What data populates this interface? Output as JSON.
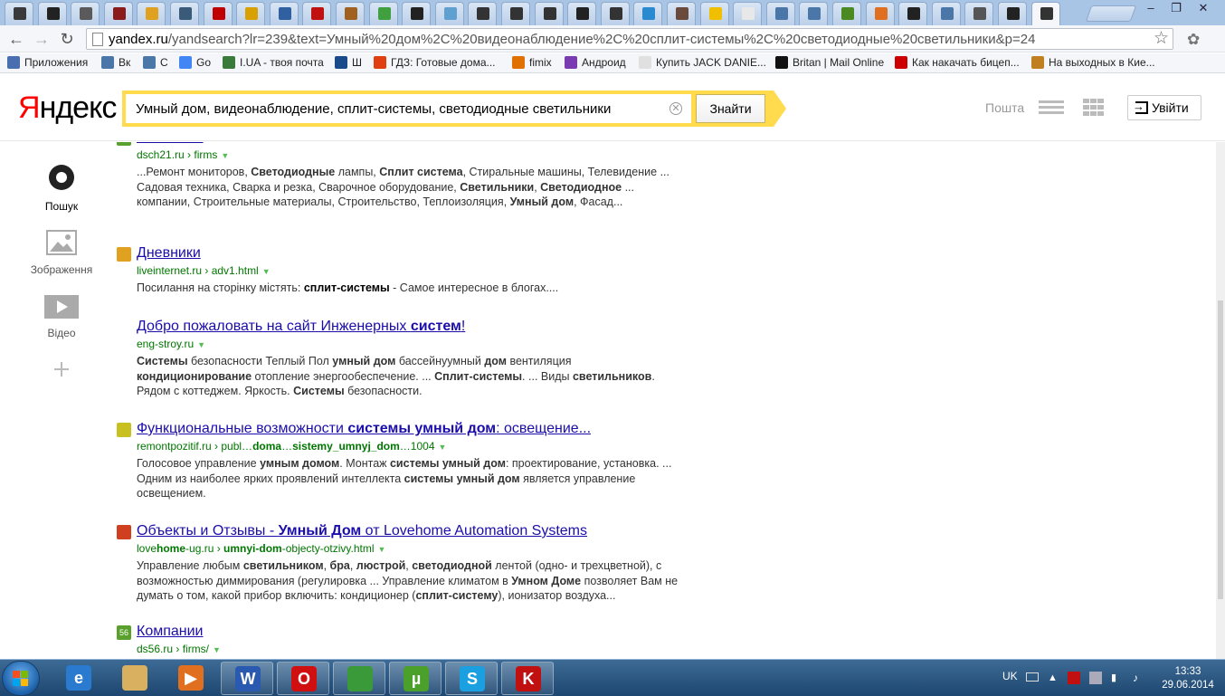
{
  "browser": {
    "tabs": [
      {
        "color": "#3a3a3a"
      },
      {
        "color": "#222222"
      },
      {
        "color": "#5a5a5a"
      },
      {
        "color": "#8b1a1a"
      },
      {
        "color": "#e0a020"
      },
      {
        "color": "#3a5a7a"
      },
      {
        "color": "#c00000"
      },
      {
        "color": "#d8a000"
      },
      {
        "color": "#3060a0"
      },
      {
        "color": "#c01010"
      },
      {
        "color": "#a06020"
      },
      {
        "color": "#40a040"
      },
      {
        "color": "#222222"
      },
      {
        "color": "#60a0d0"
      },
      {
        "color": "#333333"
      },
      {
        "color": "#333333"
      },
      {
        "color": "#333333"
      },
      {
        "color": "#222222"
      },
      {
        "color": "#333333"
      },
      {
        "color": "#2a8ad0"
      },
      {
        "color": "#6a4a3a"
      },
      {
        "color": "#f0c000"
      },
      {
        "color": "#e8e8e8"
      },
      {
        "color": "#4a76a8"
      },
      {
        "color": "#4a76a8"
      },
      {
        "color": "#4a8a20"
      },
      {
        "color": "#e07020"
      },
      {
        "color": "#222222"
      },
      {
        "color": "#4a76a8"
      },
      {
        "color": "#555555"
      },
      {
        "color": "#222222"
      },
      {
        "color": "#333333"
      }
    ],
    "address": {
      "domain": "yandex.ru",
      "path": "/yandsearch?lr=239&text=Умный%20дом%2C%20видеонаблюдение%2C%20сплит-системы%2C%20светодиодные%20светильники&p=24"
    },
    "bookmarks": [
      {
        "label": "Приложения",
        "color": "#4a6fb0"
      },
      {
        "label": "Вк",
        "color": "#4a76a8"
      },
      {
        "label": "С",
        "color": "#4a76a8"
      },
      {
        "label": "Go",
        "color": "#4285f4"
      },
      {
        "label": "I.UA - твоя почта",
        "color": "#3a7a3a"
      },
      {
        "label": "Ш",
        "color": "#1a4a8a"
      },
      {
        "label": "ГДЗ: Готовые дома...",
        "color": "#e04010"
      },
      {
        "label": "fimix",
        "color": "#e07000"
      },
      {
        "label": "Андроид",
        "color": "#7a3ab0"
      },
      {
        "label": "Купить JACK DANIE...",
        "color": "#e0e0e0"
      },
      {
        "label": "Britan | Mail Online",
        "color": "#111111"
      },
      {
        "label": "Как накачать бицеп...",
        "color": "#cc0000"
      },
      {
        "label": "На выходных в Кие...",
        "color": "#c08020"
      }
    ]
  },
  "yandex": {
    "logo_black": "ндекс",
    "logo_red": "Я",
    "search_query": "Умный дом, видеонаблюдение, сплит-системы, светодиодные светильники",
    "search_button": "Знайти",
    "mail": "Пошта",
    "login": "Увійти"
  },
  "left_nav": [
    {
      "label": "Пошук",
      "icon": "search-circle-icon"
    },
    {
      "label": "Зображення",
      "icon": "image-icon"
    },
    {
      "label": "Відео",
      "icon": "video-play-icon"
    },
    {
      "label": "",
      "icon": "plus-icon"
    }
  ],
  "results": [
    {
      "title_html": "Компании",
      "fav_color": "#5aa02c",
      "url": "dsch21.ru › firms",
      "snippet": "...Ремонт мониторов, <b>Светодиодные</b> лампы, <b>Сплит система</b>, Стиральные машины, Телевидение ... Садовая техника, Сварка и резка, Сварочное оборудование, <b>Светильники</b>, <b>Светодиодное</b> ... компании, Строительные материалы, Строительство, Теплоизоляция, <b>Умный дом</b>, Фасад..."
    },
    {
      "title_html": "Дневники",
      "fav_color": "#e0a020",
      "url": "liveinternet.ru › adv1.html",
      "snippet": "Посилання на сторінку містять: <b style=\"color:#000\">сплит-системы</b> - Самое интересное в блогах...."
    },
    {
      "title_html": "Добро пожаловать на сайт Инженерных <b>систем</b>!",
      "fav_color": "",
      "url": "eng-stroy.ru",
      "snippet": "<b>Системы</b> безопасности Теплый Пол <b>умный дом</b> бассейнуумный <b>дом</b> вентиляция <b>кондиционирование</b> отопление энергообеспечение. ... <b>Сплит-системы</b>. ... Виды <b>светильников</b>. Рядом с коттеджем. Яркость. <b>Системы</b> безопасности."
    },
    {
      "title_html": "Функциональные возможности <b>системы умный дом</b>: освещение...",
      "fav_color": "#c8c020",
      "url": "remontpozitif.ru › publ…<b>doma</b>…<b>sistemy_umnyj_dom</b>…1004",
      "snippet": "Голосовое управление <b>умным домом</b>. Монтаж <b>системы умный дом</b>: проектирование, установка. ... Одним из наиболее ярких проявлений интеллекта <b>системы умный дом</b> является управление освещением."
    },
    {
      "title_html": "Объекты и Отзывы - <b>Умный Дом</b> от Lovehome Automation Systems",
      "fav_color": "#d04020",
      "url": "love<b>home</b>-ug.ru › <b>umnyi-dom</b>-objecty-otzivy.html",
      "snippet": "Управление любым <b>светильником</b>, <b>бра</b>, <b>люстрой</b>, <b>светодиодной</b> лентой (одно- и трехцветной), с возможностью диммирования (регулировка ... Управление климатом в <b>Умном Доме</b> позволяет Вам не думать о том, какой прибор включить: кондиционер (<b>сплит-систему</b>), ионизатор воздуха..."
    },
    {
      "title_html": "Компании",
      "fav_color": "#5aa02c",
      "fav_text": "56",
      "url": "ds56.ru › firms/",
      "snippet": ""
    }
  ],
  "taskbar": {
    "apps": [
      {
        "name": "ie",
        "color": "#2a7ad0",
        "glyph": "e"
      },
      {
        "name": "explorer",
        "color": "#d8b060",
        "glyph": ""
      },
      {
        "name": "media-player",
        "color": "#e07020",
        "glyph": "▶"
      },
      {
        "name": "word",
        "color": "#2a5ab0",
        "glyph": "W"
      },
      {
        "name": "opera",
        "color": "#d01010",
        "glyph": "O"
      },
      {
        "name": "chrome",
        "color": "#3a9a3a",
        "glyph": ""
      },
      {
        "name": "utorrent",
        "color": "#4aa02a",
        "glyph": "µ"
      },
      {
        "name": "skype",
        "color": "#1aa0e0",
        "glyph": "S"
      },
      {
        "name": "kaspersky",
        "color": "#c01010",
        "glyph": "K"
      }
    ],
    "lang": "UK",
    "time": "13:33",
    "date": "29.06.2014"
  }
}
